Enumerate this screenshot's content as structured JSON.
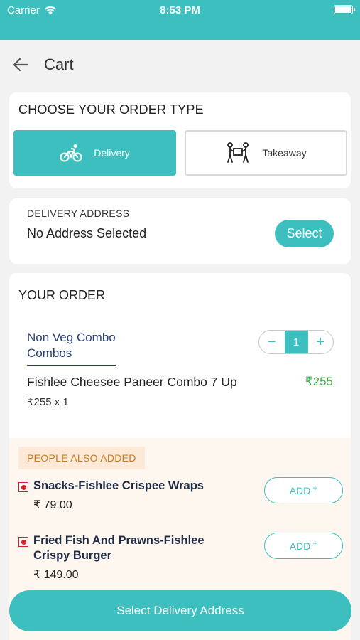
{
  "status_bar": {
    "carrier": "Carrier",
    "time": "8:53 PM"
  },
  "nav": {
    "title": "Cart"
  },
  "order_type": {
    "heading": "CHOOSE YOUR ORDER TYPE",
    "selected": "Delivery",
    "delivery_label": "Delivery",
    "takeaway_label": "Takeaway"
  },
  "address": {
    "label": "DELIVERY ADDRESS",
    "value": "No Address Selected",
    "select_label": "Select"
  },
  "your_order": {
    "heading": "YOUR ORDER",
    "combo_name": "Non Veg Combo Combos",
    "quantity": "1",
    "minus": "−",
    "plus": "+",
    "item_name": "Fishlee Cheesee Paneer Combo 7 Up",
    "item_price": "₹255",
    "item_qty_line": "₹255 x 1"
  },
  "people_also_added": {
    "badge": "PEOPLE ALSO ADDED",
    "items": [
      {
        "name": "Snacks-Fishlee Crispee Wraps",
        "price": "₹ 79.00",
        "add_label": "ADD",
        "add_plus": "+"
      },
      {
        "name": "Fried Fish And Prawns-Fishlee Crispy Burger",
        "price": "₹ 149.00",
        "add_label": "ADD",
        "add_plus": "+"
      }
    ]
  },
  "bottom_button": {
    "label": "Select Delivery Address"
  },
  "colors": {
    "accent": "#3dbfbf",
    "price_green": "#3cb043",
    "nonveg_red": "#d32323",
    "badge_text": "#c87b1e"
  }
}
